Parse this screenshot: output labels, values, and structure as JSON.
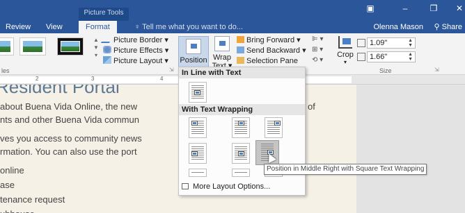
{
  "titlebar": {
    "context_label": "Picture Tools",
    "tabs": [
      "Review",
      "View",
      "Format"
    ],
    "active_tab": "Format",
    "tell_me": "Tell me what you want to do...",
    "user": "Olenna Mason",
    "share": "Share"
  },
  "ribbon": {
    "picture_border": "Picture Border",
    "picture_effects": "Picture Effects",
    "picture_layout": "Picture Layout",
    "styles_group": "les",
    "position": "Position",
    "wrap_text_1": "Wrap",
    "wrap_text_2": "Text",
    "bring_forward": "Bring Forward",
    "send_backward": "Send Backward",
    "selection_pane": "Selection Pane",
    "crop": "Crop",
    "height": "1.09\"",
    "width": "1.66\"",
    "size_group": "Size"
  },
  "ruler": {
    "marks": [
      "2",
      "3",
      "4"
    ]
  },
  "document": {
    "title": "Resident Portal",
    "lines": [
      "about Buena Vida Online, the new",
      "nts and other Buena Vida commun",
      "ves you access to community news",
      "rmation. You can also use the port",
      "online",
      "ase",
      "tenance request",
      "ubhouse"
    ],
    "tail_of": "of"
  },
  "position_menu": {
    "inline_header": "In Line with Text",
    "wrap_header": "With Text Wrapping",
    "more": "More Layout Options...",
    "tooltip": "Position in Middle Right with Square Text Wrapping"
  },
  "colors": {
    "title_bar": "#2b579a",
    "ribbon": "#f3f3f3",
    "page": "#f6f1e7",
    "heading": "#5c7a95",
    "highlight": "#c5c5c5"
  }
}
